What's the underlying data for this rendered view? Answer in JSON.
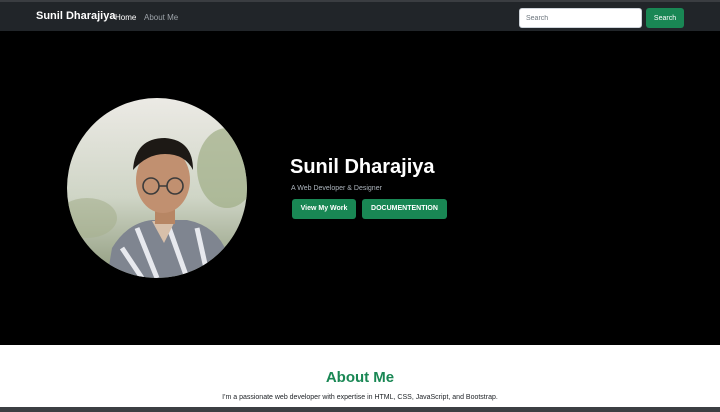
{
  "navbar": {
    "brand": "Sunil Dharajiya",
    "links": [
      {
        "label": "Home",
        "active": true
      },
      {
        "label": "About Me",
        "active": false
      }
    ],
    "search": {
      "placeholder": "Search",
      "value": "",
      "button_label": "Search"
    }
  },
  "hero": {
    "name": "Sunil Dharajiya",
    "tagline": "A Web Developer & Designer",
    "buttons": {
      "work": "View My Work",
      "docs": "DOCUMENTENTION"
    }
  },
  "about": {
    "title": "About Me",
    "text": "I'm a passionate web developer with expertise in HTML, CSS, JavaScript, and Bootstrap.",
    "text_continued": "…"
  },
  "colors": {
    "accent": "#198754",
    "navbar": "#212529",
    "hero_bg": "#000000"
  }
}
